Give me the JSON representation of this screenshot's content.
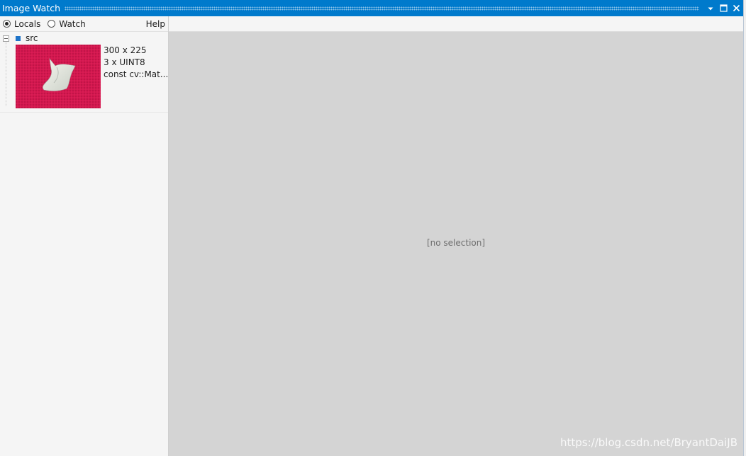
{
  "window": {
    "title": "Image Watch"
  },
  "toolbar": {
    "locals_label": "Locals",
    "watch_label": "Watch",
    "help_label": "Help",
    "selected_mode": "Locals"
  },
  "items": [
    {
      "name": "src",
      "dims": "300 x 225",
      "channels": "3 x UINT8",
      "type": "const cv::Mat..."
    }
  ],
  "view": {
    "empty_text": "[no selection]"
  },
  "watermark": "https://blog.csdn.net/BryantDaiJB",
  "icons": {
    "titlebar": [
      "dropdown-icon",
      "maximize-icon",
      "close-icon"
    ]
  },
  "colors": {
    "titlebar": "#007acc",
    "view_background": "#d4d4d4",
    "panel_background": "#f5f5f5",
    "var_marker": "#1e73c8"
  }
}
